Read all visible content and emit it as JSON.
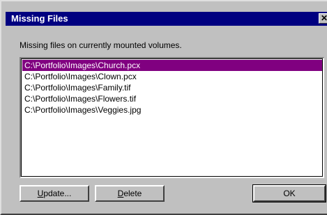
{
  "window": {
    "title": "Missing Files",
    "close_glyph": "✕",
    "close_icon": "close-icon"
  },
  "message": "Missing files on currently mounted volumes.",
  "files": [
    {
      "path": "C:\\Portfolio\\Images\\Church.pcx",
      "selected": true
    },
    {
      "path": "C:\\Portfolio\\Images\\Clown.pcx",
      "selected": false
    },
    {
      "path": "C:\\Portfolio\\Images\\Family.tif",
      "selected": false
    },
    {
      "path": "C:\\Portfolio\\Images\\Flowers.tif",
      "selected": false
    },
    {
      "path": "C:\\Portfolio\\Images\\Veggies.jpg",
      "selected": false
    }
  ],
  "buttons": {
    "update_accel": "U",
    "update_rest": "pdate...",
    "delete_accel": "D",
    "delete_rest": "elete",
    "ok": "OK"
  },
  "colors": {
    "titlebar": "#000080",
    "selection": "#800080",
    "face": "#c0c0c0"
  }
}
